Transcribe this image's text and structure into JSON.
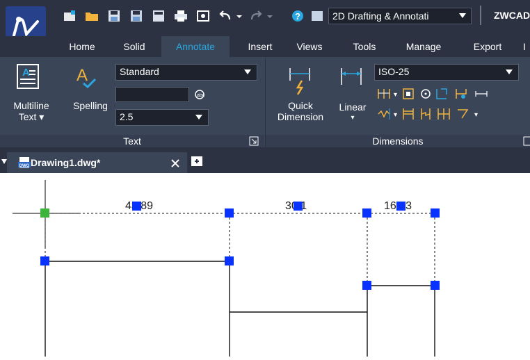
{
  "window": {
    "workspace_label": "2D Drafting & Annotati",
    "product_label": "ZWCAD"
  },
  "tabs": [
    {
      "label": "Home"
    },
    {
      "label": "Solid"
    },
    {
      "label": "Annotate"
    },
    {
      "label": "Insert"
    },
    {
      "label": "Views"
    },
    {
      "label": "Tools"
    },
    {
      "label": "Manage"
    },
    {
      "label": "Export"
    }
  ],
  "active_tab": "Annotate",
  "ribbon": {
    "text_panel": {
      "title": "Text",
      "multiline_line1": "Multiline",
      "multiline_line2": "Text",
      "spelling": "Spelling",
      "style": "Standard",
      "height": "2.5"
    },
    "dim_panel": {
      "title": "Dimensions",
      "quick_line1": "Quick",
      "quick_line2": "Dimension",
      "linear": "Linear",
      "style": "ISO-25"
    }
  },
  "document": {
    "tab_title": "Drawing1.dwg*",
    "dwg_badge": "DWG"
  },
  "drawing": {
    "dim1": "43.89",
    "dim2": "30.1",
    "dim3": "16.23"
  },
  "colors": {
    "accent": "#2aa6e0",
    "grip": "#0a32ff",
    "grip_selected": "#3cb43c",
    "ribbon_bg": "#3b4558",
    "title_bg": "#2c3242"
  }
}
